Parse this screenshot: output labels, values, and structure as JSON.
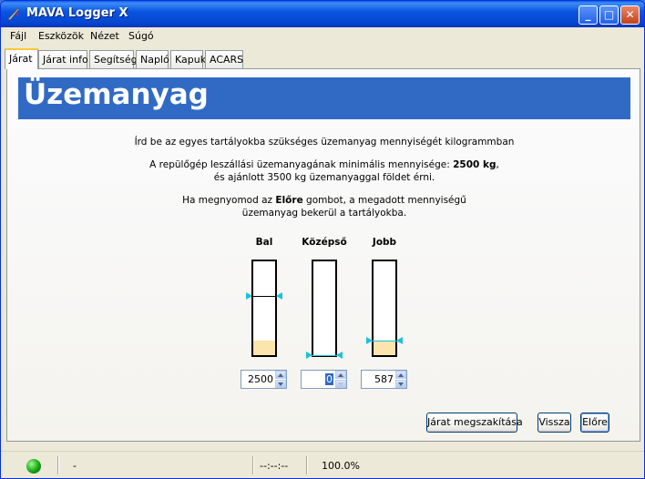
{
  "window": {
    "title": "MAVA Logger X",
    "controls": {
      "minimize": "_",
      "maximize": "□",
      "close": "✕"
    }
  },
  "menu": [
    "Fájl",
    "Eszközök",
    "Nézet",
    "Súgó"
  ],
  "tabs": [
    "Járat",
    "Járat info",
    "Segítség",
    "Napló",
    "Kapuk",
    "ACARS"
  ],
  "active_tab": "Járat",
  "page": {
    "header": "Üzemanyag",
    "intro": "Írd be az egyes tartályokba szükséges üzemanyag mennyiségét kilogrammban",
    "min_fuel_line1_pre": "A repülőgép leszállási üzemanyagának minimális mennyisége: ",
    "min_fuel_value": "2500 kg",
    "min_fuel_line1_post": ",",
    "min_fuel_line2": "és ajánlott 3500 kg üzemanyaggal földet érni.",
    "next_line1_pre": "Ha megnyomod az ",
    "next_line1_bold": "Előre",
    "next_line1_post": " gombot, a megadott mennyiségű",
    "next_line2": "üzemanyag bekerül a tartályokba."
  },
  "tanks": [
    {
      "label": "Bal",
      "value": "2500",
      "fill_fraction": 0.16,
      "marker_fraction": 0.63
    },
    {
      "label": "Középső",
      "value": "0",
      "fill_fraction": 0.0,
      "marker_fraction": 0.0
    },
    {
      "label": "Jobb",
      "value": "587",
      "fill_fraction": 0.16,
      "marker_fraction": 0.16
    }
  ],
  "buttons": {
    "abort": "Járat megszakítása",
    "back": "Vissza",
    "next": "Előre"
  },
  "status": {
    "connection_color": "#14a514",
    "text1": "-",
    "time": "--:--:--",
    "percent": "100.0%"
  }
}
